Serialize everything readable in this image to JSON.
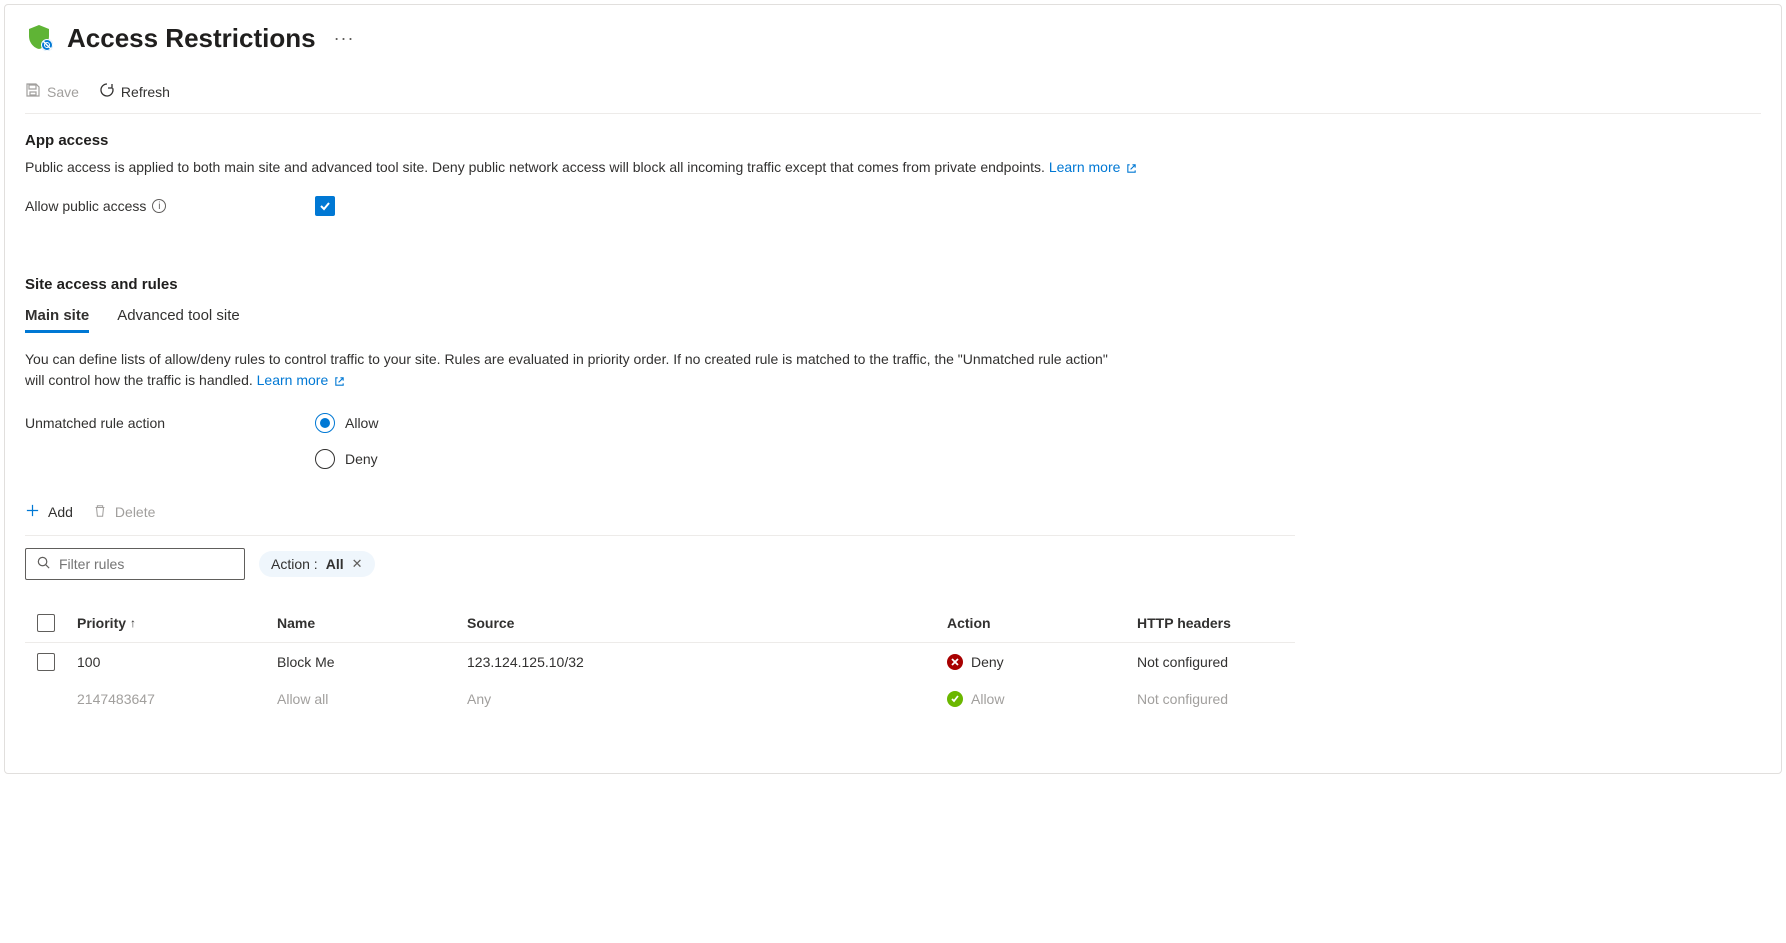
{
  "header": {
    "title": "Access Restrictions"
  },
  "toolbar": {
    "save_label": "Save",
    "refresh_label": "Refresh"
  },
  "app_access": {
    "heading": "App access",
    "description": "Public access is applied to both main site and advanced tool site. Deny public network access will block all incoming traffic except that comes from private endpoints.",
    "learn_more": "Learn more",
    "allow_public_label": "Allow public access",
    "allow_public_checked": true
  },
  "site_access": {
    "heading": "Site access and rules",
    "tabs": {
      "main": "Main site",
      "advanced": "Advanced tool site"
    },
    "description_part1": "You can define lists of allow/deny rules to control traffic to your site. Rules are evaluated in priority order. If no created rule is matched to the traffic, the \"Unmatched rule action\" will control how the traffic is handled.",
    "learn_more": "Learn more",
    "unmatched_label": "Unmatched rule action",
    "unmatched_options": {
      "allow": "Allow",
      "deny": "Deny"
    },
    "unmatched_selected": "allow"
  },
  "rules_toolbar": {
    "add_label": "Add",
    "delete_label": "Delete"
  },
  "filter": {
    "placeholder": "Filter rules",
    "pill_label": "Action :",
    "pill_value": "All"
  },
  "table": {
    "columns": {
      "priority": "Priority",
      "name": "Name",
      "source": "Source",
      "action": "Action",
      "http_headers": "HTTP headers"
    },
    "rows": [
      {
        "selectable": true,
        "priority": "100",
        "name": "Block Me",
        "source": "123.124.125.10/32",
        "action": "Deny",
        "action_type": "deny",
        "http_headers": "Not configured",
        "muted": false
      },
      {
        "selectable": false,
        "priority": "2147483647",
        "name": "Allow all",
        "source": "Any",
        "action": "Allow",
        "action_type": "allow",
        "http_headers": "Not configured",
        "muted": true
      }
    ]
  }
}
